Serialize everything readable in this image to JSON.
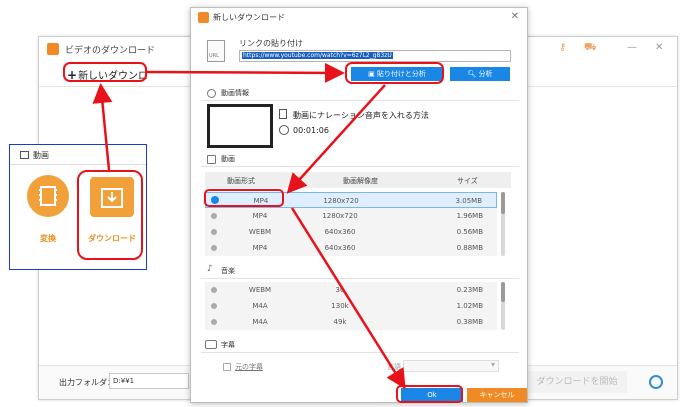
{
  "main_window": {
    "title": "ビデオのダウンロード",
    "new_download": "新しいダウンロ",
    "folder_label": "出力フォルダ：",
    "folder_value": "D:¥¥1",
    "start_download": "ダウンロードを開始"
  },
  "side_panel": {
    "title": "動画",
    "tiles": [
      {
        "label": "変換",
        "icon": "film-icon"
      },
      {
        "label": "ダウンロード",
        "icon": "download-icon"
      }
    ]
  },
  "dialog": {
    "title": "新しいダウンロード",
    "link_label": "リンクの貼り付け",
    "paste_icon_text": "URL",
    "url": "https://www.youtube.com/watch?v=6z7L2_g83zU",
    "paste_analyze": "貼り付けと分析",
    "analyze": "分析",
    "video_info_title": "動画情報",
    "video_title": "動画にナレーション音声を入れる方法",
    "duration": "00:01:06",
    "video_section_title": "動画",
    "video_columns": [
      "動画形式",
      "動画解像度",
      "サイズ"
    ],
    "video_rows": [
      {
        "format": "MP4",
        "resolution": "1280x720",
        "size": "3.05MB"
      },
      {
        "format": "MP4",
        "resolution": "1280x720",
        "size": "1.96MB"
      },
      {
        "format": "WEBM",
        "resolution": "640x360",
        "size": "0.56MB"
      },
      {
        "format": "MP4",
        "resolution": "640x360",
        "size": "0.88MB"
      }
    ],
    "audio_section_title": "音楽",
    "audio_rows": [
      {
        "format": "WEBM",
        "bitrate": "30",
        "size": "0.23MB"
      },
      {
        "format": "M4A",
        "bitrate": "130k",
        "size": "1.02MB"
      },
      {
        "format": "M4A",
        "bitrate": "49k",
        "size": "0.38MB"
      }
    ],
    "subtitle_section_title": "字幕",
    "subtitle_checkbox": "元の字幕",
    "language_label": "言語",
    "ok": "Ok",
    "cancel": "キャンセル"
  },
  "colors": {
    "accent_blue": "#1a86e6",
    "accent_orange": "#f08a24",
    "callout_red": "#e8121b",
    "panel_border": "#1d3ad0"
  }
}
